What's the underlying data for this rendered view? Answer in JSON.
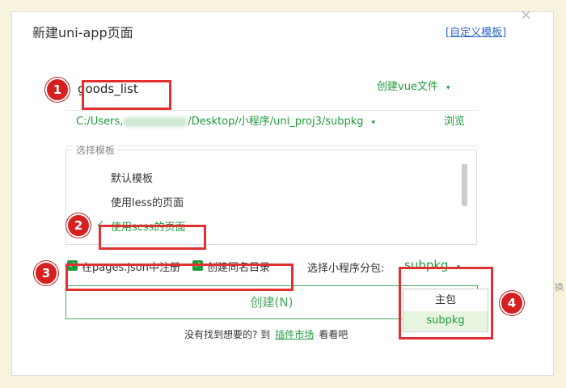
{
  "dialog": {
    "title": "新建uni-app页面",
    "custom_template_link": "[自定义模板]",
    "close_icon": "×"
  },
  "name_input": {
    "value": "goods_list"
  },
  "create_type": {
    "label": "创建vue文件",
    "arrow": "▾"
  },
  "path": {
    "prefix": "C:/Users,",
    "suffix": "/Desktop/小程序/uni_proj3/subpkg",
    "arrow": "▾",
    "browse_label": "浏览"
  },
  "templates": {
    "legend": "选择模板",
    "items": [
      {
        "label": "默认模板"
      },
      {
        "label": "使用less的页面"
      },
      {
        "label": "使用scss的页面"
      }
    ],
    "check_glyph": "✓"
  },
  "options": {
    "register_label": "在pages.json中注册",
    "same_dir_label": "创建同名目录",
    "check_glyph": "✓"
  },
  "subpackage": {
    "label": "选择小程序分包:",
    "selected": "subpkg",
    "arrow": "▾",
    "dropdown_options": [
      "主包",
      "subpkg"
    ]
  },
  "create_button": {
    "label": "创建(N)"
  },
  "footer": {
    "prefix": "没有找到想要的? 到",
    "link": "插件市场",
    "suffix": "看看吧"
  },
  "annotations": [
    "1",
    "2",
    "3",
    "4"
  ],
  "edge_char": "换",
  "colors": {
    "accent": "#1f9b3b",
    "annotation": "#e03030",
    "link": "#2b66c8"
  }
}
